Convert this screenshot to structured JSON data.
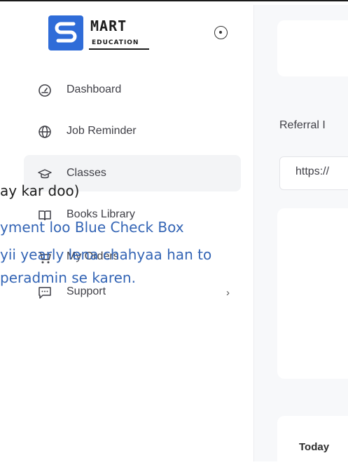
{
  "brand": {
    "name": "MART",
    "tagline": "EDUCATION",
    "accent": "#2f6cd8"
  },
  "sidebar": {
    "items": [
      {
        "label": "Dashboard",
        "icon": "gauge-icon"
      },
      {
        "label": "Job Reminder",
        "icon": "globe-icon"
      },
      {
        "label": "Classes",
        "icon": "graduation-cap-icon",
        "active": true
      },
      {
        "label": "Books Library",
        "icon": "book-open-icon"
      },
      {
        "label": "My Orders",
        "icon": "cart-icon"
      },
      {
        "label": "Support",
        "icon": "chat-icon",
        "has_submenu": true
      }
    ]
  },
  "main": {
    "referral_label": "Referral I",
    "referral_value": "https://",
    "today_label": "Today"
  },
  "overlay_text": {
    "line1": "ay kar doo)",
    "line2": "yment loo Blue Check Box",
    "line3": "yii yearly lena chahyaa han to",
    "line4": "peradmin se karen."
  }
}
